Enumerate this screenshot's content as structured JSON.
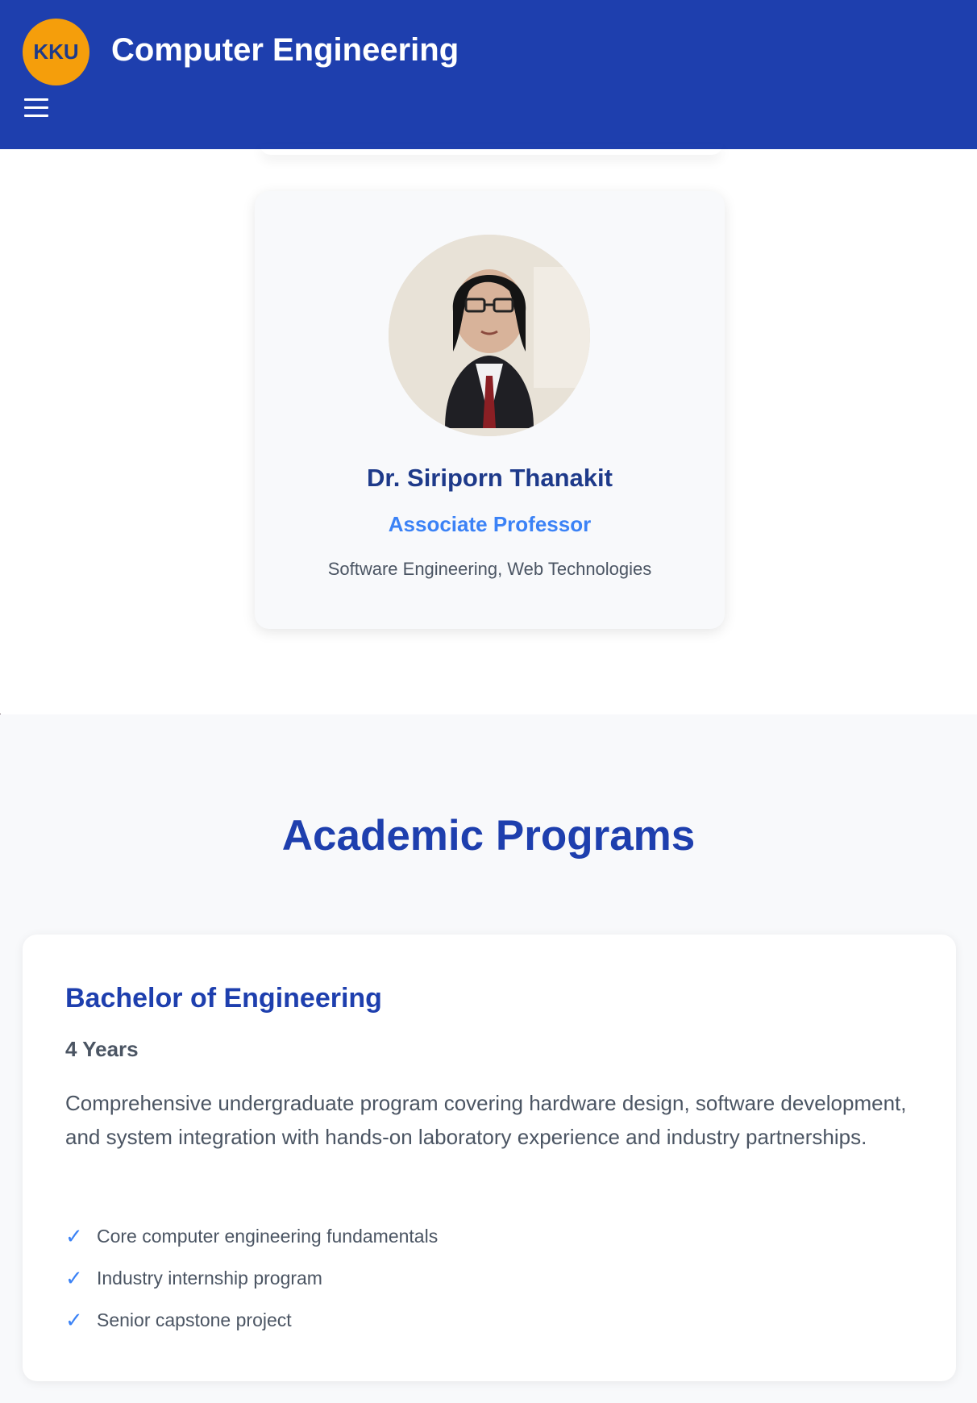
{
  "header": {
    "logo_text": "KKU",
    "title": "Computer Engineering",
    "colors": {
      "bar": "#1e3fae",
      "logo": "#f59e0b"
    },
    "menu_icon": "hamburger-menu-icon"
  },
  "faculty": {
    "name": "Dr. Siriporn Thanakit",
    "role": "Associate Professor",
    "specialization": "Software Engineering, Web Technologies"
  },
  "programs": {
    "section_title": "Academic Programs",
    "items": [
      {
        "name": "Bachelor of Engineering",
        "duration": "4 Years",
        "description": "Comprehensive undergraduate program covering hardware design, software development, and system integration with hands-on laboratory experience and industry partnerships.",
        "features": [
          "Core computer engineering fundamentals",
          "Industry internship program",
          "Senior capstone project"
        ]
      }
    ]
  }
}
